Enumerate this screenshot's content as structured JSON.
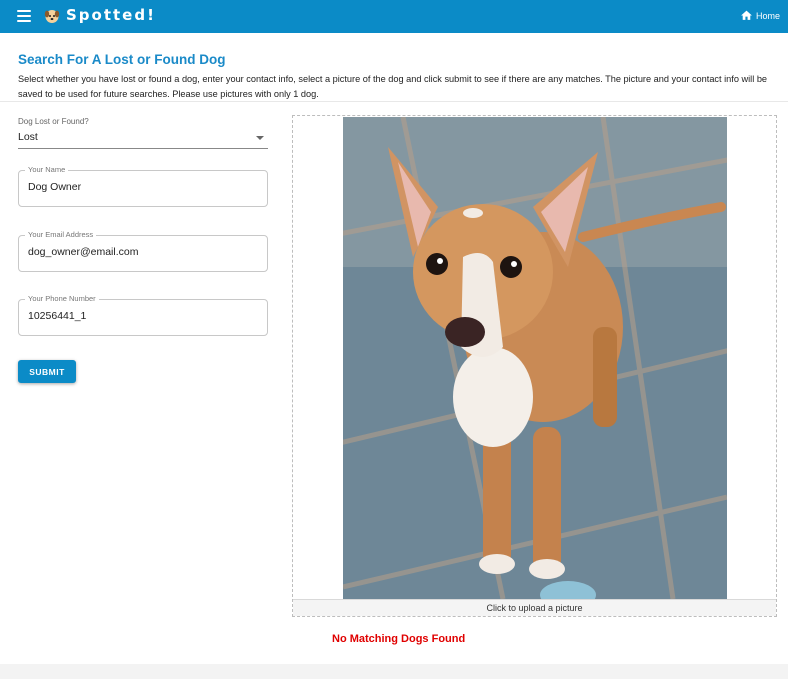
{
  "app": {
    "brand": "Spotted!",
    "home_label": "Home",
    "bar_color": "#0b8bc7",
    "icons": [
      "menu-icon",
      "dog-logo-icon",
      "home-icon"
    ]
  },
  "page": {
    "title": "Search For A Lost or Found Dog",
    "instructions": "Select whether you have lost or found a dog, enter your contact info, select a picture of the dog and click submit to see if there are any matches. The picture and your contact info will be saved to be used for future searches. Please use pictures with only 1 dog."
  },
  "form": {
    "lost_found": {
      "label": "Dog Lost or Found?",
      "value": "Lost"
    },
    "name": {
      "label": "Your Name",
      "value": "Dog Owner"
    },
    "email": {
      "label": "Your Email Address",
      "value": "dog_owner@email.com"
    },
    "phone": {
      "label": "Your Phone Number",
      "value": "10256441_1"
    },
    "submit_label": "SUBMIT"
  },
  "upload": {
    "caption": "Click to upload a picture"
  },
  "result": {
    "message": "No Matching Dogs Found",
    "color": "#e00000"
  }
}
